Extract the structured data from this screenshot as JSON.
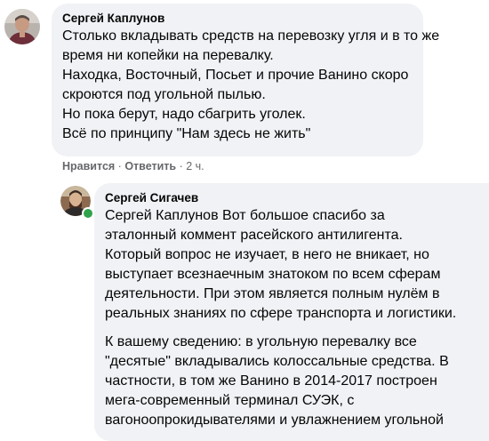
{
  "comment1": {
    "author": "Сергей Каплунов",
    "lines": [
      "Столько вкладывать средств на перевозку угля и в то же",
      "время ни копейки на перевалку.",
      "Находка, Восточный, Посьет и прочие Ванино скоро",
      "скроются под угольной пылью.",
      "Но пока берут, надо сбагрить уголек.",
      "Всё по принципу \"Нам здесь не жить\""
    ],
    "actions": {
      "like": "Нравится",
      "dot1": "·",
      "reply": "Ответить",
      "dot2": "·",
      "time": "2 ч."
    }
  },
  "comment2": {
    "author": "Сергей Сигачев",
    "tag": "Сергей Каплунов",
    "lines": [
      " Вот большое спасибо за",
      "эталонный коммент расейского антилигента.",
      "Который вопрос не изучает, в него не вникает, но",
      "выступает всезнаечным знатоком по всем сферам",
      "деятельности. При этом является полным нулём в",
      "реальных знаниях по сфере транспорта и логистики."
    ],
    "lines2": [
      "К вашему сведению: в угольную перевалку все",
      "\"десятые\" вкладывались колоссальные средства. В",
      "частности, в том же Ванино в 2014-2017 построен",
      "мега-современный терминал СУЭК, с",
      "вагоноопрокидывателями и увлажнением угольной"
    ]
  },
  "colors": {
    "bubble": "#f0f2f5",
    "meta": "#65676b",
    "online": "#31a24c"
  }
}
